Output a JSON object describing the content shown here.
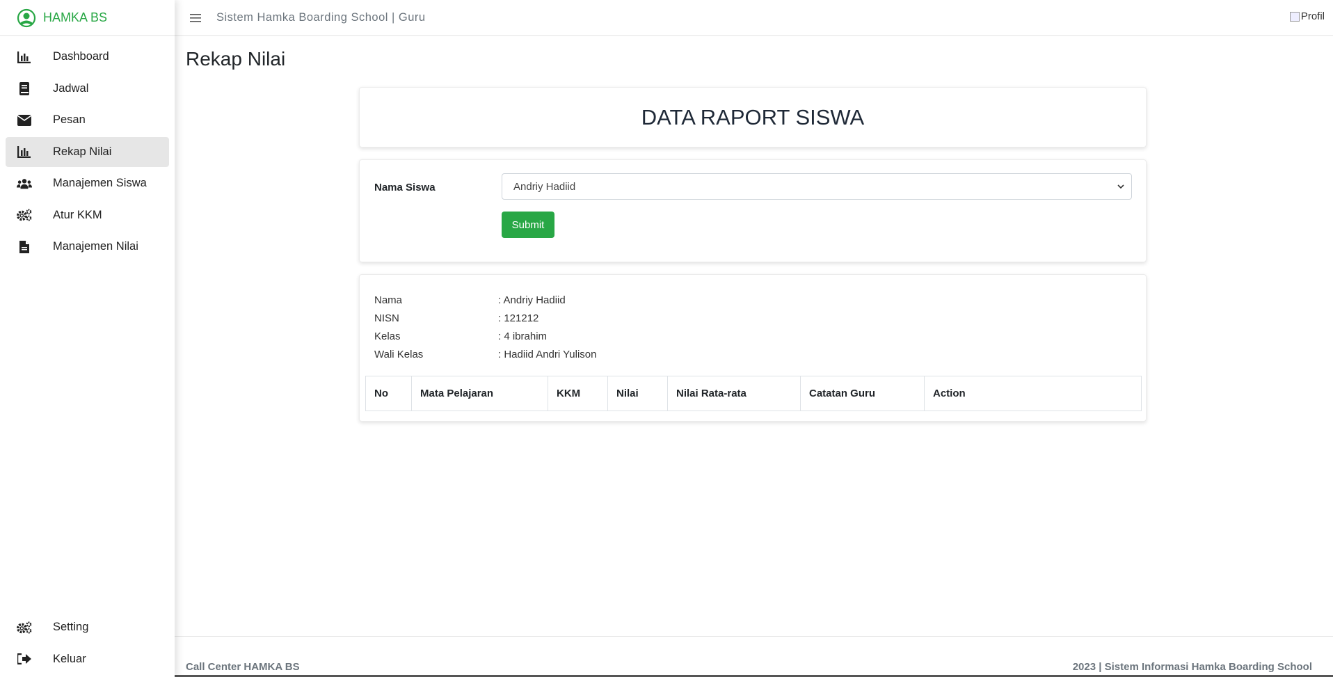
{
  "brand": {
    "name": "HAMKA BS",
    "logo_icon": "hamka-logo-icon",
    "color": "#28a745"
  },
  "topbar": {
    "title": "Sistem Hamka Boarding School | Guru",
    "profile_alt": "Profil"
  },
  "sidebar": {
    "items": [
      {
        "label": "Dashboard",
        "icon": "chart-bar-icon",
        "active": false
      },
      {
        "label": "Jadwal",
        "icon": "book-icon",
        "active": false
      },
      {
        "label": "Pesan",
        "icon": "envelope-icon",
        "active": false
      },
      {
        "label": "Rekap Nilai",
        "icon": "chart-bar-icon",
        "active": true
      },
      {
        "label": "Manajemen Siswa",
        "icon": "users-icon",
        "active": false
      },
      {
        "label": "Atur KKM",
        "icon": "cogs-icon",
        "active": false
      },
      {
        "label": "Manajemen Nilai",
        "icon": "file-icon",
        "active": false
      }
    ],
    "bottom_items": [
      {
        "label": "Setting",
        "icon": "cogs-icon"
      },
      {
        "label": "Keluar",
        "icon": "sign-out-icon"
      }
    ]
  },
  "page": {
    "title": "Rekap Nilai"
  },
  "report_header": {
    "title": "DATA RAPORT SISWA"
  },
  "form": {
    "label": "Nama Siswa",
    "selected": "Andriy Hadiid",
    "submit_label": "Submit",
    "submit_color": "#28a745"
  },
  "student_info": {
    "rows": [
      {
        "key": "Nama",
        "value": ": Andriy Hadiid"
      },
      {
        "key": "NISN",
        "value": ": 121212"
      },
      {
        "key": "Kelas",
        "value": ": 4 ibrahim"
      },
      {
        "key": "Wali Kelas",
        "value": ": Hadiid Andri Yulison"
      }
    ]
  },
  "table": {
    "columns": [
      "No",
      "Mata Pelajaran",
      "KKM",
      "Nilai",
      "Nilai Rata-rata",
      "Catatan Guru",
      "Action"
    ],
    "rows": []
  },
  "footer": {
    "left": "Call Center HAMKA BS",
    "right": "2023 | Sistem Informasi Hamka Boarding School"
  }
}
